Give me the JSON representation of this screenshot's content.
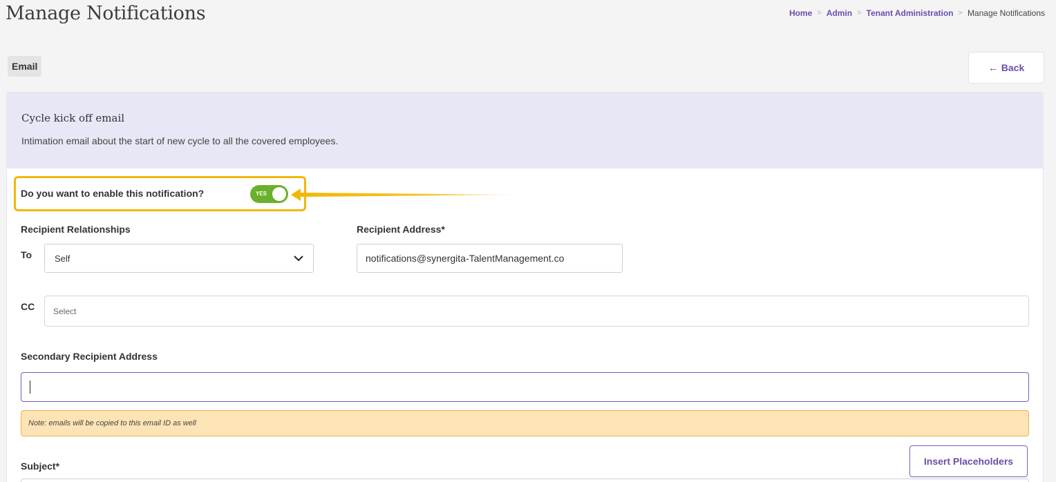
{
  "page": {
    "title": "Manage Notifications"
  },
  "breadcrumb": {
    "items": [
      "Home",
      "Admin",
      "Tenant Administration"
    ],
    "current": "Manage Notifications"
  },
  "tab": {
    "label": "Email"
  },
  "back_button": {
    "label": "Back",
    "icon": "arrow-left-icon"
  },
  "notification": {
    "title": "Cycle kick off email",
    "description": "Intimation email about the start of new cycle to all the covered employees."
  },
  "enable": {
    "question": "Do you want to enable this notification?",
    "toggle_label": "YES",
    "enabled": true
  },
  "recipients": {
    "relationships_label": "Recipient Relationships",
    "to_label": "To",
    "to_value": "Self",
    "address_label": "Recipient Address*",
    "address_value": "notifications@synergita-TalentManagement.co",
    "cc_label": "CC",
    "cc_placeholder": "Select"
  },
  "secondary": {
    "label": "Secondary Recipient Address",
    "value": "",
    "note": "Note: emails will be copied to this email ID as well"
  },
  "subject": {
    "label": "Subject*"
  },
  "insert_placeholders": {
    "label": "Insert Placeholders"
  },
  "colors": {
    "accent": "#6b4ea8",
    "toggle_on": "#6ab02d",
    "highlight": "#f2b705",
    "header_bg": "#e8e7f6",
    "note_bg": "#fde4b6"
  }
}
